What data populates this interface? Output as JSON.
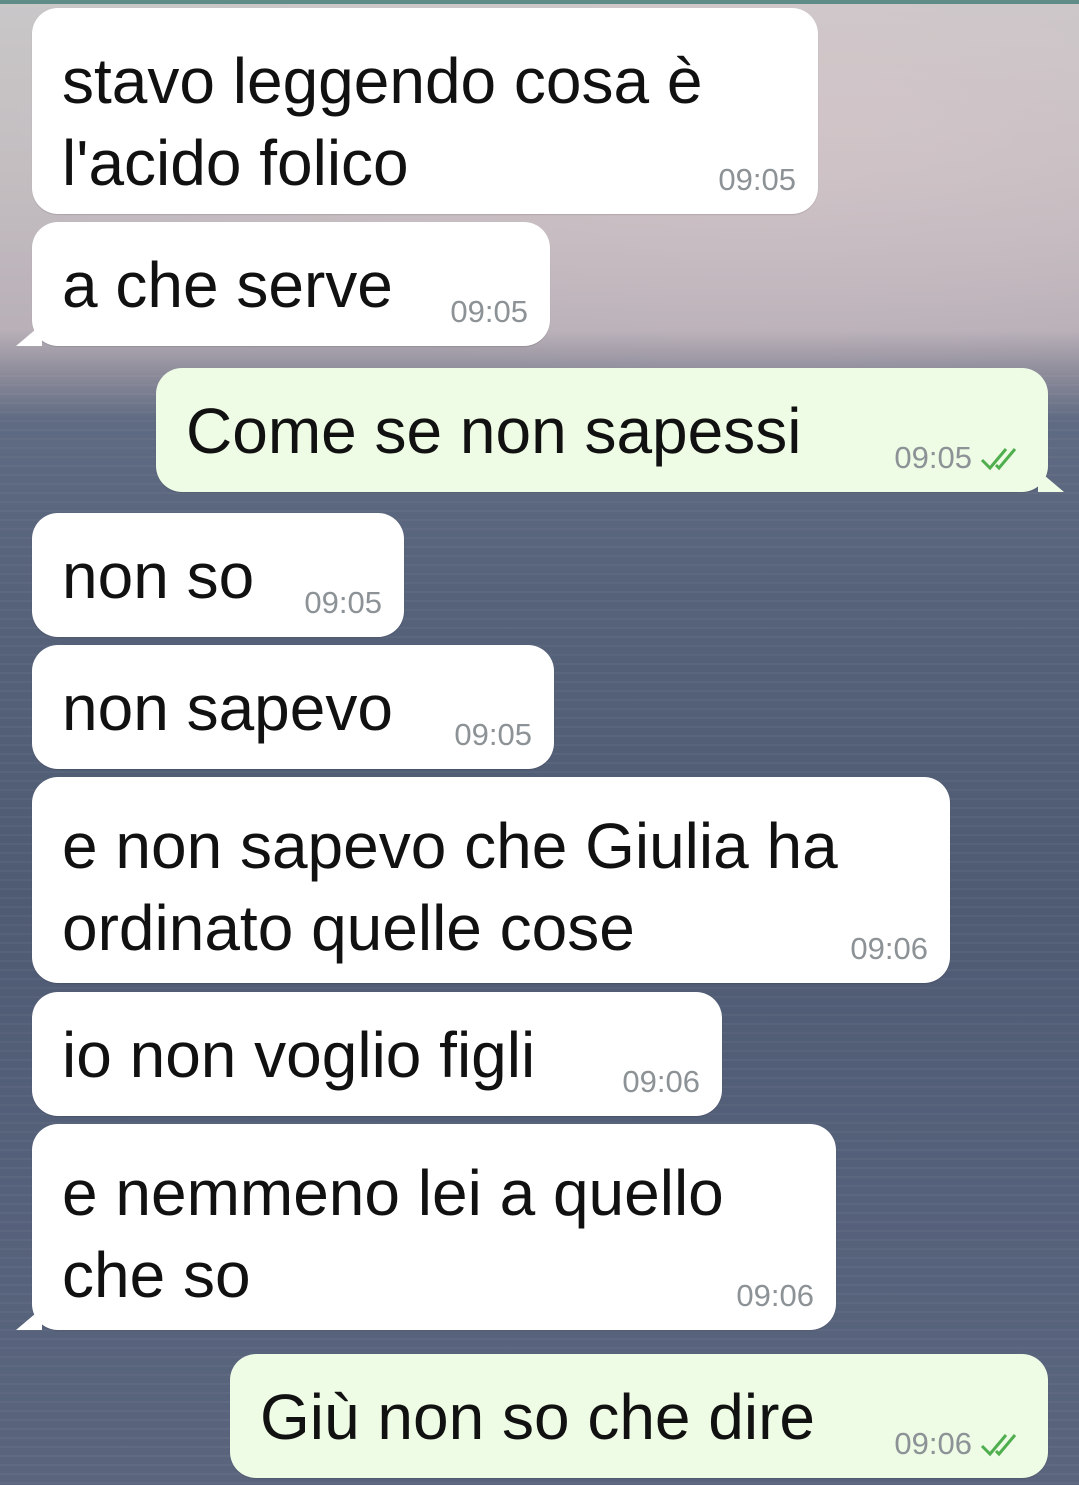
{
  "colors": {
    "incoming_bubble": "#ffffff",
    "outgoing_bubble": "#eefbe5",
    "timestamp": "#8c9295",
    "read_ticks": "#4fae4e"
  },
  "messages": [
    {
      "direction": "in",
      "text": "stavo leggendo cosa è\nl'acido folico",
      "time": "09:05"
    },
    {
      "direction": "in",
      "text": "a che serve",
      "time": "09:05"
    },
    {
      "direction": "out",
      "text": "Come se non sapessi",
      "time": "09:05",
      "status_icon": "double-check-icon"
    },
    {
      "direction": "in",
      "text": "non so",
      "time": "09:05"
    },
    {
      "direction": "in",
      "text": "non sapevo",
      "time": "09:05"
    },
    {
      "direction": "in",
      "text": "e non sapevo che Giulia ha\nordinato quelle cose",
      "time": "09:06"
    },
    {
      "direction": "in",
      "text": "io non voglio figli",
      "time": "09:06"
    },
    {
      "direction": "in",
      "text": "e nemmeno lei a quello\nche so",
      "time": "09:06"
    },
    {
      "direction": "out",
      "text": "Giù non so che dire",
      "time": "09:06",
      "status_icon": "double-check-icon"
    }
  ]
}
